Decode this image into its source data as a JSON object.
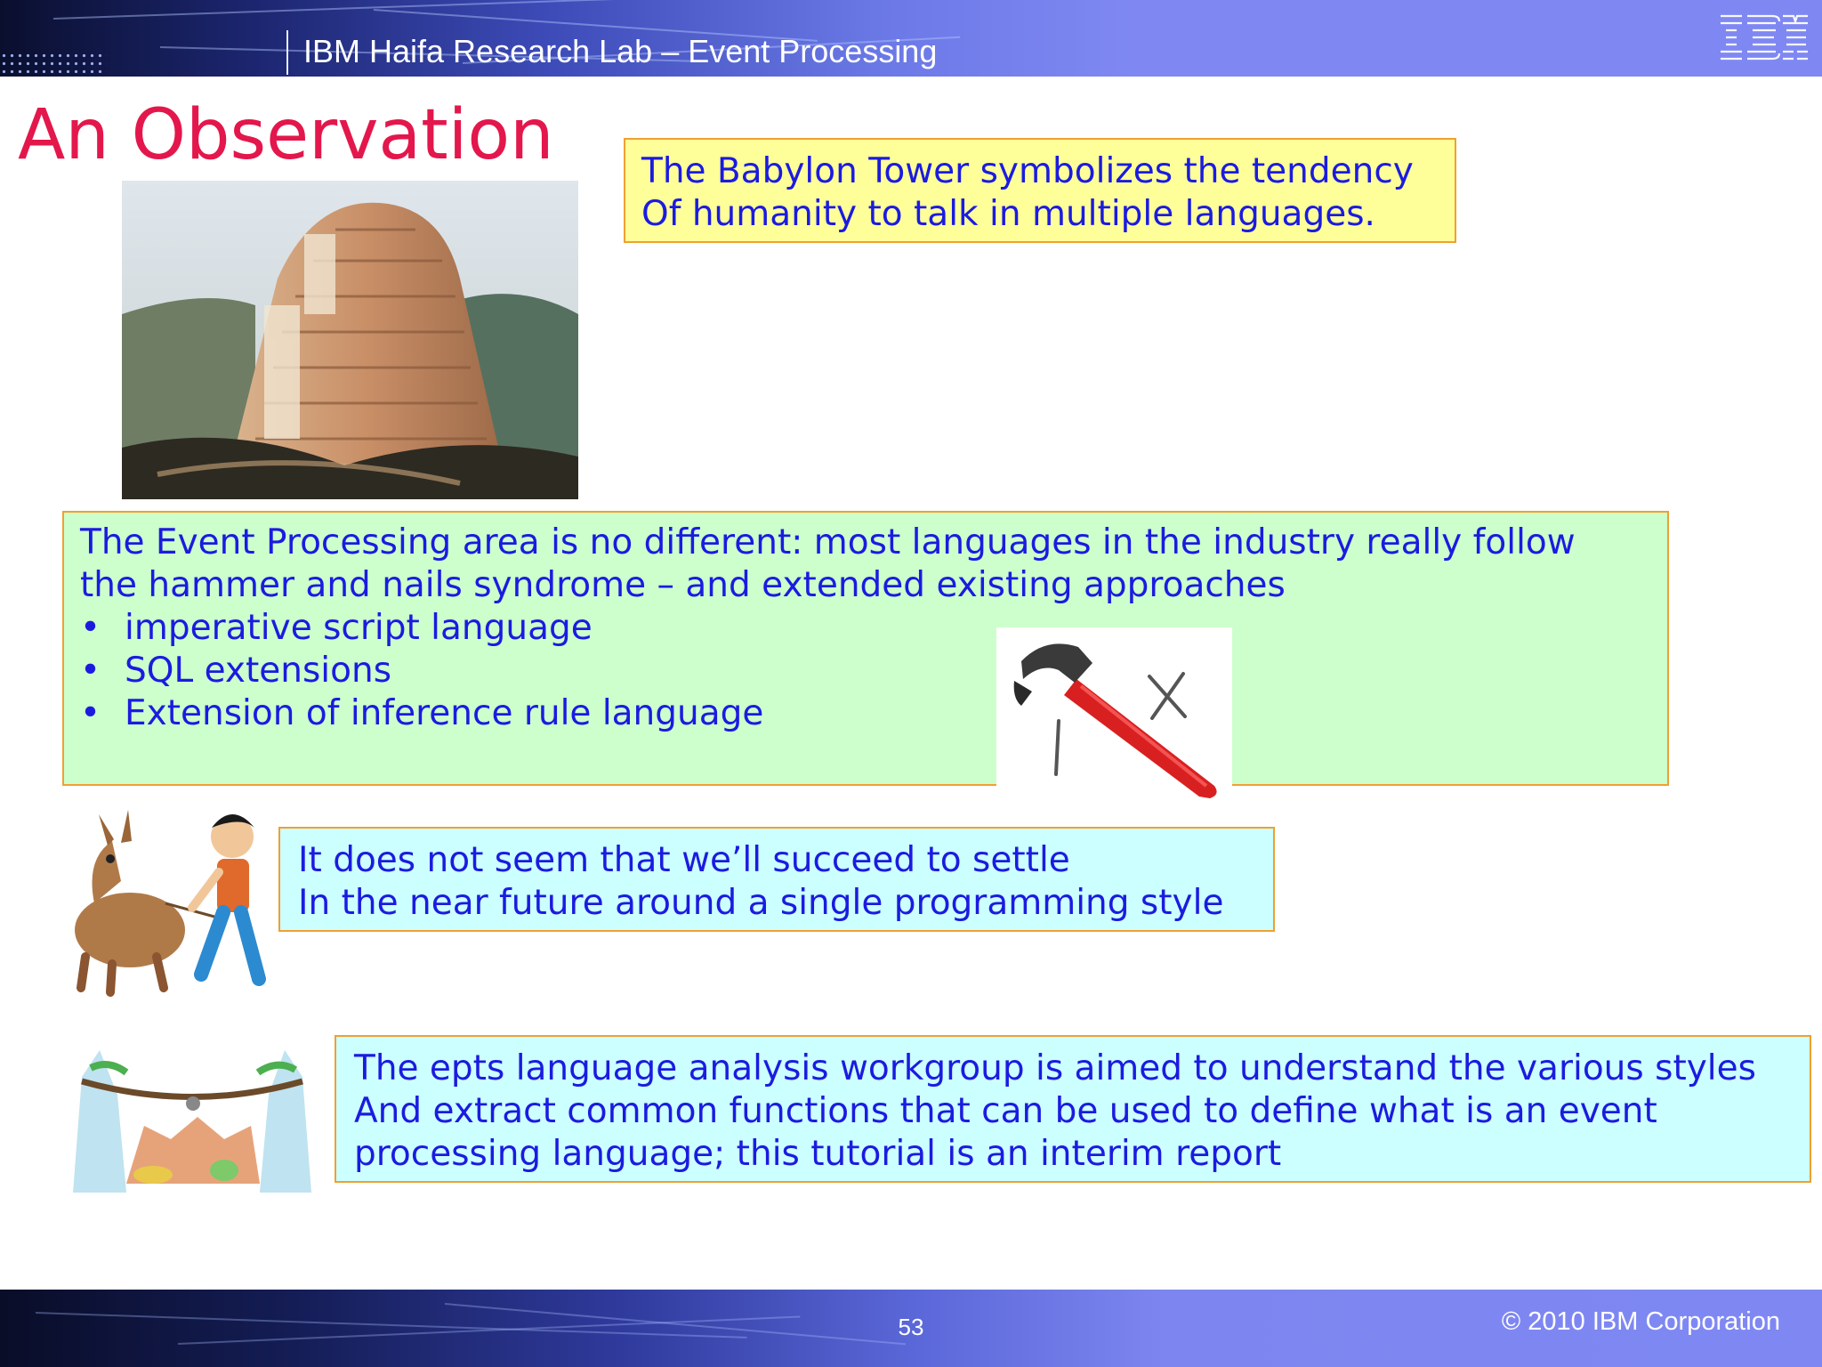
{
  "header": {
    "title": "IBM Haifa Research Lab – Event Processing",
    "logo_text": "IBM"
  },
  "slide": {
    "title": "An Observation",
    "babylon_note": {
      "lines": [
        "The Babylon Tower symbolizes the tendency",
        "Of humanity  to talk in multiple languages."
      ]
    },
    "ep_note": {
      "lines": [
        "The Event Processing area is no different:   most languages in the industry really follow",
        "the hammer and nails syndrome – and extended existing approaches"
      ],
      "bullets": [
        "imperative script language",
        "SQL extensions",
        "Extension of inference rule language"
      ]
    },
    "settle_note": {
      "lines": [
        "It does not seem that we’ll succeed to settle",
        "In the near future around a single programming style"
      ]
    },
    "epts_note": {
      "lines": [
        "The epts language analysis workgroup is aimed to understand the various styles",
        "And extract common functions that can be used to define what is an event",
        "processing language; this tutorial is an interim report"
      ]
    }
  },
  "footer": {
    "page_number": "53",
    "copyright": "© 2010 IBM Corporation"
  },
  "colors": {
    "title": "#e3174b",
    "note_text": "#1b1be0",
    "note_border": "#f0a030",
    "yellow_note": "#ffff99",
    "green_note": "#ccffcc",
    "cyan_note": "#ccffff",
    "band": "#7f88f2"
  }
}
